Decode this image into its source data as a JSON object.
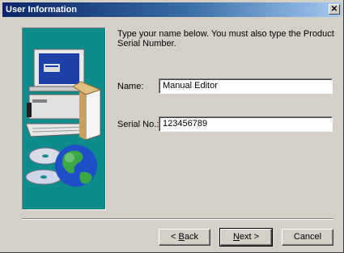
{
  "window": {
    "title": "User Information",
    "close_glyph": "✕"
  },
  "content": {
    "intro": "Type your name below. You must also type the Product Serial Number.",
    "name_label": "Name:",
    "name_value": "Manual Editor",
    "serial_label": "Serial No.:",
    "serial_value": "123456789"
  },
  "buttons": {
    "back": {
      "prefix": "< ",
      "mnemonic": "B",
      "rest": "ack"
    },
    "next": {
      "mnemonic": "N",
      "rest": "ext >"
    },
    "cancel": "Cancel"
  },
  "icons": {
    "illustration": [
      "computer-icon",
      "cd-disc-icon",
      "globe-icon",
      "software-box-icon"
    ],
    "background_color": "#0e8b8b"
  }
}
